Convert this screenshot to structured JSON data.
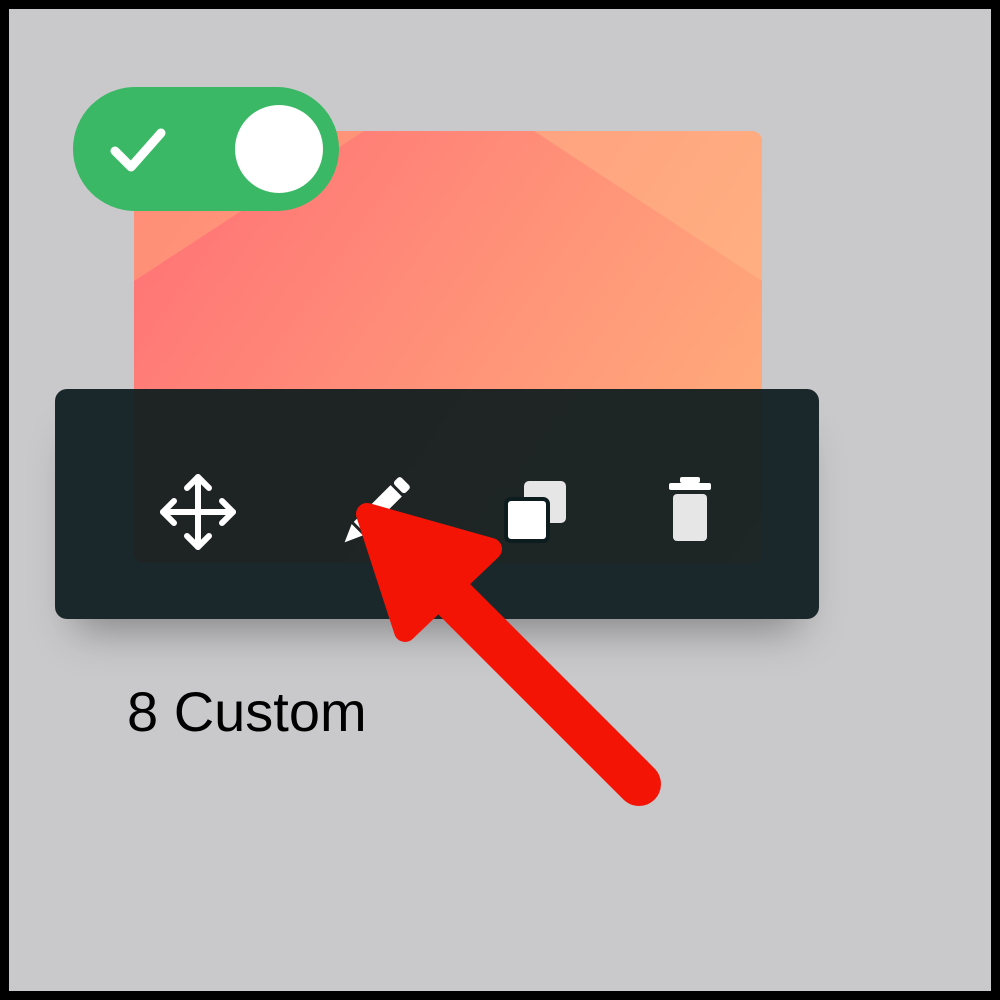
{
  "card": {
    "name": "8 Custom",
    "enabled": true
  },
  "toggle": {
    "state": "on",
    "check_icon": "check-icon",
    "color": "#3bb865"
  },
  "toolbar": {
    "actions": [
      {
        "name": "move",
        "icon": "move-icon"
      },
      {
        "name": "edit",
        "icon": "pencil-icon"
      },
      {
        "name": "duplicate",
        "icon": "duplicate-icon"
      },
      {
        "name": "delete",
        "icon": "trash-icon"
      }
    ],
    "background": "#0d1c1e"
  },
  "annotation": {
    "type": "arrow",
    "points_to": "edit",
    "color": "#f41406"
  },
  "colors": {
    "canvas": "#c9c9cb",
    "thumbnail_start": "#ff6f76",
    "thumbnail_end": "#ffb27c"
  }
}
